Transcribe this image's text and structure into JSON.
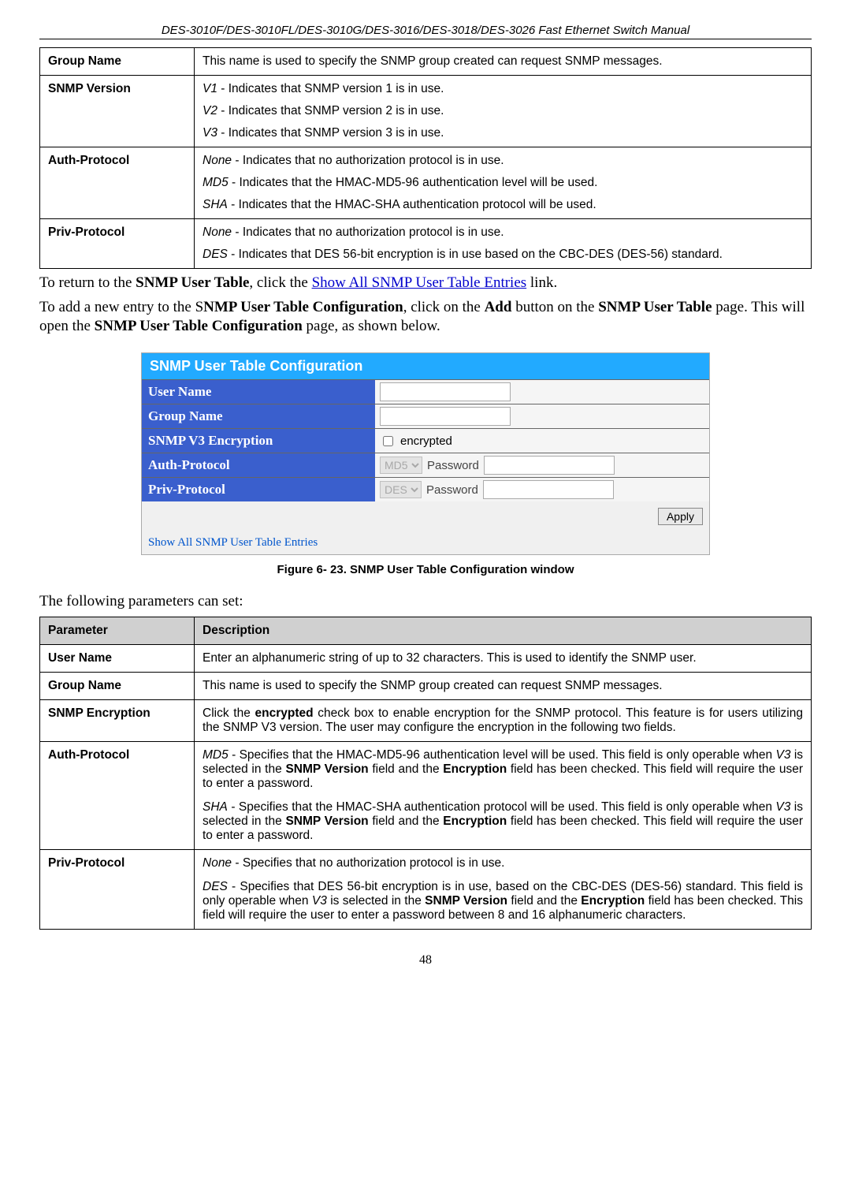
{
  "header": "DES-3010F/DES-3010FL/DES-3010G/DES-3016/DES-3018/DES-3026 Fast Ethernet Switch Manual",
  "table1": {
    "r1": {
      "label": "Group Name",
      "text": "This name is used to specify the SNMP group created can request SNMP messages."
    },
    "r2": {
      "label": "SNMP Version",
      "l1a": "V1",
      "l1b": " - Indicates that SNMP version 1 is in use.",
      "l2a": "V2",
      "l2b": " - Indicates that SNMP version 2 is in use.",
      "l3a": "V3",
      "l3b": " - Indicates that SNMP version 3 is in use."
    },
    "r3": {
      "label": "Auth-Protocol",
      "l1a": "None",
      "l1b": " - Indicates that no authorization protocol is in use.",
      "l2a": "MD5",
      "l2b": " - Indicates that the HMAC-MD5-96 authentication level will be used.",
      "l3a": "SHA",
      "l3b": " - Indicates that the HMAC-SHA authentication protocol will be used."
    },
    "r4": {
      "label": "Priv-Protocol",
      "l1a": "None",
      "l1b": " - Indicates that no authorization protocol is in use.",
      "l2a": "DES",
      "l2b": " - Indicates that DES 56-bit encryption is in use based on the CBC-DES (DES-56) standard."
    }
  },
  "para1": {
    "p1": "To return to the ",
    "b1": "SNMP User Table",
    "p2": ", click the ",
    "link": "Show All SNMP User Table Entries",
    "p3": " link."
  },
  "para2": {
    "p1": "To add a new entry to the S",
    "b1": "NMP User Table Configuration",
    "p2": ", click on the ",
    "b2": "Add",
    "p3": " button on the ",
    "b3": "SNMP User Table",
    "p4": " page.  This will open the ",
    "b4": "SNMP User Table Configuration",
    "p5": " page, as shown below."
  },
  "fig": {
    "title": "SNMP User Table Configuration",
    "r1": "User Name",
    "r2": "Group Name",
    "r3": "SNMP V3 Encryption",
    "r3chk": "encrypted",
    "r4": "Auth-Protocol",
    "r4sel": "MD5",
    "r4pw": "Password",
    "r5": "Priv-Protocol",
    "r5sel": "DES",
    "r5pw": "Password",
    "apply": "Apply",
    "footerlink": "Show All SNMP User Table Entries"
  },
  "caption": "Figure 6- 23. SNMP User Table Configuration window",
  "para3": "The following parameters can set:",
  "table2": {
    "h1": "Parameter",
    "h2": "Description",
    "r1": {
      "label": "User Name",
      "text": "Enter an alphanumeric string of up to 32 characters. This is used to identify the SNMP user."
    },
    "r2": {
      "label": "Group Name",
      "text": "This name is used to specify the SNMP group created can request SNMP messages."
    },
    "r3": {
      "label": "SNMP Encryption",
      "p1": "Click the ",
      "b1": "encrypted",
      "p2": " check box to enable encryption for the SNMP protocol. This feature is for users utilizing the SNMP V3 version. The user may configure the encryption in the following two fields."
    },
    "r4": {
      "label": "Auth-Protocol",
      "p1a": "MD5",
      "p1b": " - Specifies that the HMAC-MD5-96 authentication level will be used. This field is only operable when ",
      "p1c": "V3",
      "p1d": " is selected in the ",
      "p1e": "SNMP Version",
      "p1f": " field and the ",
      "p1g": "Encryption",
      "p1h": " field has been checked. This field will require the user to enter a password.",
      "p2a": "SHA",
      "p2b": " - Specifies that the HMAC-SHA authentication protocol will be used. This field is only operable when ",
      "p2c": "V3",
      "p2d": " is selected in the ",
      "p2e": "SNMP Version",
      "p2f": " field and the ",
      "p2g": "Encryption",
      "p2h": " field has been checked. This field will require the user to enter a password."
    },
    "r5": {
      "label": "Priv-Protocol",
      "p1a": "None",
      "p1b": " - Specifies that no authorization protocol is in use.",
      "p2a": "DES",
      "p2b": " - Specifies that DES 56-bit encryption is in use, based on the CBC-DES (DES-56) standard. This field is only operable when ",
      "p2c": "V3",
      "p2d": " is selected in the ",
      "p2e": "SNMP Version",
      "p2f": " field and the ",
      "p2g": "Encryption",
      "p2h": " field has been checked. This field will require the user to enter a password between 8 and 16 alphanumeric characters."
    }
  },
  "pagenum": "48"
}
